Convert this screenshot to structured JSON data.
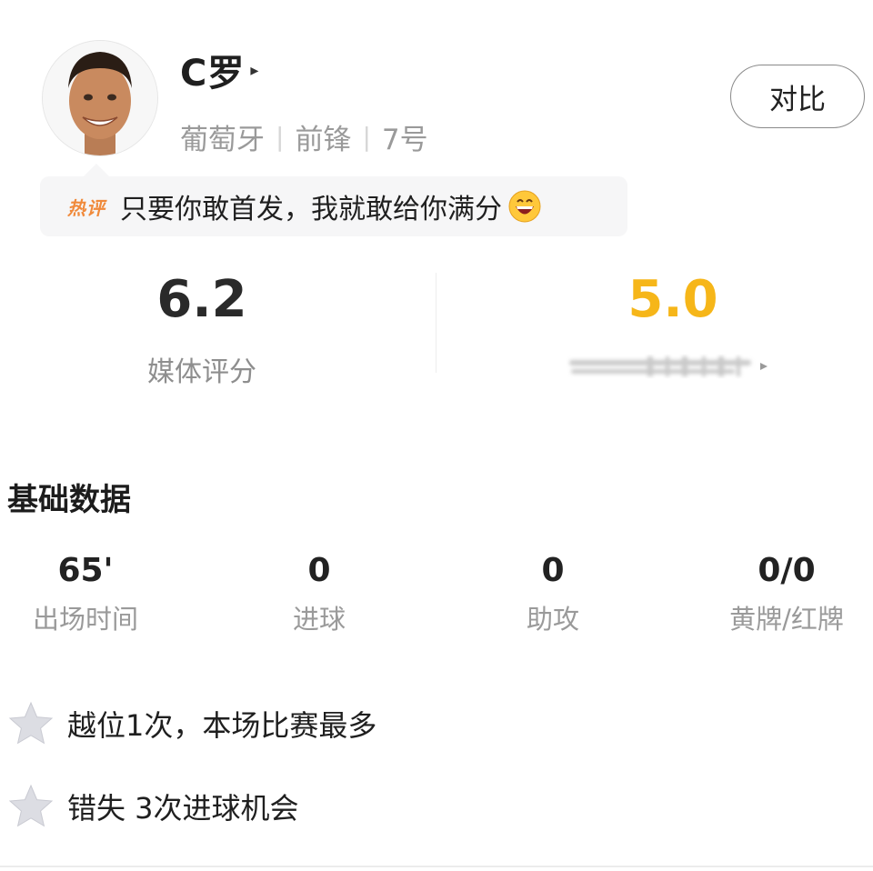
{
  "player": {
    "name": "C罗",
    "arrow": "▸",
    "country": "葡萄牙",
    "position": "前锋",
    "number": "7号"
  },
  "compare_button": "对比",
  "hot_comment": {
    "badge": "热评",
    "text": "只要你敢首发，我就敢给你满分",
    "emoji": "grinning-face-icon"
  },
  "ratings": {
    "media": {
      "value": "6.2",
      "label": "媒体评分"
    },
    "user": {
      "value": "5.0"
    }
  },
  "basic_data": {
    "title": "基础数据",
    "stats": [
      {
        "value": "65'",
        "label": "出场时间"
      },
      {
        "value": "0",
        "label": "进球"
      },
      {
        "value": "0",
        "label": "助攻"
      },
      {
        "value": "0/0",
        "label": "黄牌/红牌"
      }
    ]
  },
  "notes": [
    {
      "icon": "star-icon",
      "text": "越位1次，本场比赛最多"
    },
    {
      "icon": "star-icon",
      "text": "错失 3次进球机会"
    }
  ],
  "colors": {
    "user_rating": "#f6b619",
    "hot_badge": "#f08a3b",
    "muted_text": "#9a9a9a"
  }
}
